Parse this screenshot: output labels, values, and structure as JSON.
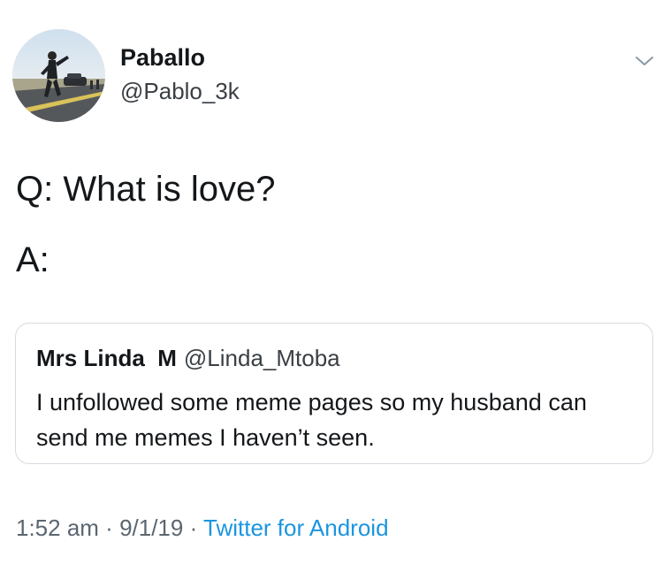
{
  "tweet": {
    "author": {
      "display_name": "Paballo",
      "handle": "@Pablo_3k",
      "avatar_icon": "avatar-photo-road"
    },
    "menu_icon": "chevron-down-icon",
    "text_lines": [
      "Q: What is love?",
      "A:"
    ],
    "quoted_tweet": {
      "display_name": "Mrs Linda  M",
      "handle": "@Linda_Mtoba",
      "text": "I unfollowed some meme pages so my husband can send me memes I haven’t seen."
    },
    "meta": {
      "time": "1:52 am",
      "separator": " · ",
      "date": "9/1/19",
      "source": "Twitter for Android"
    }
  },
  "colors": {
    "text": "#14171a",
    "secondary": "#5c6670",
    "link": "#1b95e0",
    "border": "#d6dbe0"
  }
}
